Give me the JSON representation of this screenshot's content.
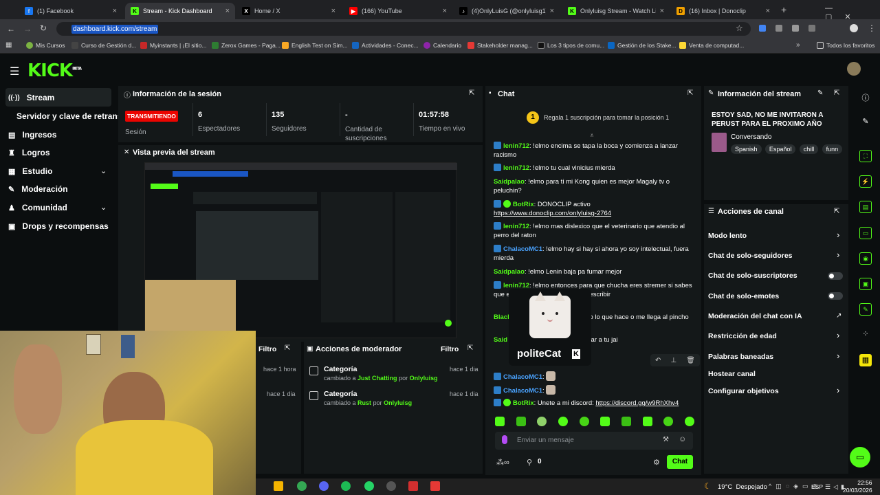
{
  "browser": {
    "tabs": [
      {
        "label": "(1) Facebook",
        "color": "#1877f2",
        "glyph": "f"
      },
      {
        "label": "Stream - Kick Dashboard",
        "color": "#53fc18",
        "glyph": "K"
      },
      {
        "label": "Home / X",
        "color": "#000000",
        "glyph": "X"
      },
      {
        "label": "(166) YouTube",
        "color": "#ff0000",
        "glyph": "▶"
      },
      {
        "label": "(4)OnlyLuisG (@onlyluisg1) | Ti",
        "color": "#000000",
        "glyph": "♪"
      },
      {
        "label": "Onlyluisg Stream - Watch Live",
        "color": "#53fc18",
        "glyph": "K"
      },
      {
        "label": "(16) Inbox | Donoclip",
        "color": "#f0a000",
        "glyph": "D"
      }
    ],
    "url": "dashboard.kick.com/stream",
    "bookmarks": [
      "Mis Cursos",
      "Curso de Gestión d...",
      "Myinstants | ¡El sitio...",
      "Zerox Games - Paga...",
      "English Test on Sim...",
      "Actividades - Conec...",
      "Calendario",
      "Stakeholder manag...",
      "Los 3 tipos de comu...",
      "Gestión de los Stake...",
      "Venta de computad..."
    ],
    "all_favorites": "Todos los favoritos"
  },
  "kick": {
    "logo": "KICK",
    "logo_sup": "BETA"
  },
  "sidebar": {
    "items": [
      {
        "label": "Stream",
        "icon": "broadcast-icon"
      },
      {
        "label": "Servidor y clave de retransm",
        "icon": ""
      },
      {
        "label": "Ingresos",
        "icon": "money-icon"
      },
      {
        "label": "Logros",
        "icon": "trophy-icon"
      },
      {
        "label": "Estudio",
        "icon": "studio-icon"
      },
      {
        "label": "Moderación",
        "icon": "wrench-icon"
      },
      {
        "label": "Comunidad",
        "icon": "people-icon"
      },
      {
        "label": "Drops y recompensas",
        "icon": "gift-icon"
      }
    ]
  },
  "session": {
    "title": "Información de la sesión",
    "live_badge": "TRANSMITIENDO",
    "live_label": "Sesión",
    "stats": [
      {
        "value": "6",
        "label": "Espectadores"
      },
      {
        "value": "135",
        "label": "Seguidores"
      },
      {
        "value": "-",
        "label": "Cantidad de suscripciones"
      },
      {
        "value": "01:57:58",
        "label": "Tiempo en vivo"
      }
    ]
  },
  "preview": {
    "title": "Vista previa del stream"
  },
  "filter_panel": {
    "filter": "Filtro",
    "rows": [
      {
        "time": "hace 1 hora"
      },
      {
        "time": "hace 1 dia"
      }
    ]
  },
  "mod_actions": {
    "title": "Acciones de moderador",
    "filter": "Filtro",
    "rows": [
      {
        "title": "Categoría",
        "pre": "cambiado a",
        "target": "Just Chatting",
        "by": "por",
        "user": "Onlyluisg",
        "time": "hace 1 dia"
      },
      {
        "title": "Categoría",
        "pre": "cambiado a",
        "target": "Rust",
        "by": "por",
        "user": "Onlyluisg",
        "time": "hace 1 dia"
      }
    ]
  },
  "chat": {
    "title": "Chat",
    "rank": "1",
    "gift_prompt": "Regala 1 suscripción para tomar la posición 1",
    "messages": [
      {
        "user": "lenin712",
        "color": "#53fc18",
        "text": ": !elmo encima se tapa la boca y comienza a lanzar racismo"
      },
      {
        "user": "lenin712",
        "color": "#53fc18",
        "text": ": !elmo tu cual vinicius mierda"
      },
      {
        "user": "Saidpalao",
        "color": "#53fc18",
        "text": ": !elmo para ti mi Kong quien es mejor Magaly tv o peluchin?"
      },
      {
        "user": "BotRix",
        "color": "#53fc18",
        "text": ": DONOCLIP activo",
        "link": "https://www.donoclip.com/onlyluisg-2764"
      },
      {
        "user": "lenin712",
        "color": "#53fc18",
        "text": ": !elmo mas dislexico que el veterinario que atendio al perro del raton"
      },
      {
        "user": "ChalacoMC1",
        "color": "#4aa3ff",
        "text": ": !elmo hay si hay si ahora yo soy intelectual, fuera mierda"
      },
      {
        "user": "Saidpalao",
        "color": "#53fc18",
        "text": ": !elmo Lenin baja pa fumar mejor"
      },
      {
        "user": "lenin712",
        "color": "#53fc18",
        "text": ": !elmo entonces para que chucha eres stremer si sabes que el",
        "extra": "dibujitos que escriben por escribir"
      },
      {
        "user": "Black",
        "color": "#53fc18",
        "text": "chalaco tanta huevada todo lo que hace",
        "extra": "o me llega al pincho"
      },
      {
        "user": "Said",
        "color": "#53fc18",
        "text": "igues vendiendo Mari pa bajar a tu jai"
      },
      {
        "user": "ChalacoMC1",
        "color": "#4aa3ff",
        "text": ":"
      },
      {
        "user": "ChalacoMC1",
        "color": "#4aa3ff",
        "text": ":"
      },
      {
        "user": "BotRix",
        "color": "#53fc18",
        "text": ": Unete a mi discord:",
        "link": "https://discord.gg/w9RhXhv4"
      }
    ],
    "emote_name": "politeCat",
    "input_placeholder": "Enviar un mensaje",
    "points": "0",
    "send": "Chat"
  },
  "stream_info": {
    "title": "Información del stream",
    "stream_title": "ESTOY SAD, NO ME INVITARON A PERUST PARA EL PROXIMO AÑO SERA....",
    "category": "Conversando",
    "tags": [
      "Spanish",
      "Español",
      "chill",
      "funn"
    ]
  },
  "channel_actions": {
    "title": "Acciones de canal",
    "rows": [
      {
        "label": "Modo lento",
        "control": "chevron"
      },
      {
        "label": "Chat de solo-seguidores",
        "control": "chevron"
      },
      {
        "label": "Chat de solo-suscriptores",
        "control": "toggle"
      },
      {
        "label": "Chat de solo-emotes",
        "control": "toggle"
      },
      {
        "label": "Moderación del chat con IA",
        "control": "external"
      },
      {
        "label": "Restricción de edad",
        "control": "chevron"
      },
      {
        "label": "Palabras baneadas",
        "control": "chevron"
      },
      {
        "label": "Hostear canal",
        "control": "none"
      },
      {
        "label": "Configurar objetivos",
        "control": "chevron"
      }
    ]
  },
  "taskbar": {
    "weather": "19°C  Despejado",
    "lang": "ESP",
    "time": "22:56",
    "date": "20/03/2026"
  },
  "colors": {
    "accent": "#53fc18",
    "live": "#eb0400",
    "panel": "#141819",
    "bg": "#0b0e0f"
  }
}
